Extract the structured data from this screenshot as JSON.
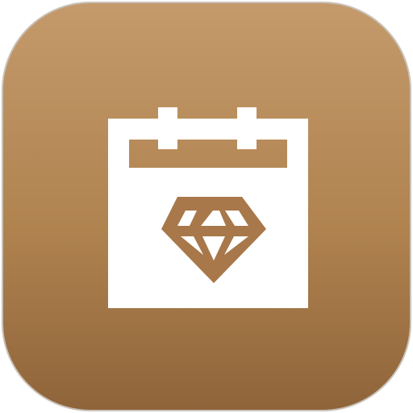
{
  "app": {
    "icon_name": "calendar-diamond-icon",
    "colors": {
      "gradient_top": "#c49a6c",
      "gradient_bottom": "#8f643a",
      "glyph": "#ffffff",
      "diamond": "#a8784a",
      "border": "#c9c2ba"
    }
  }
}
